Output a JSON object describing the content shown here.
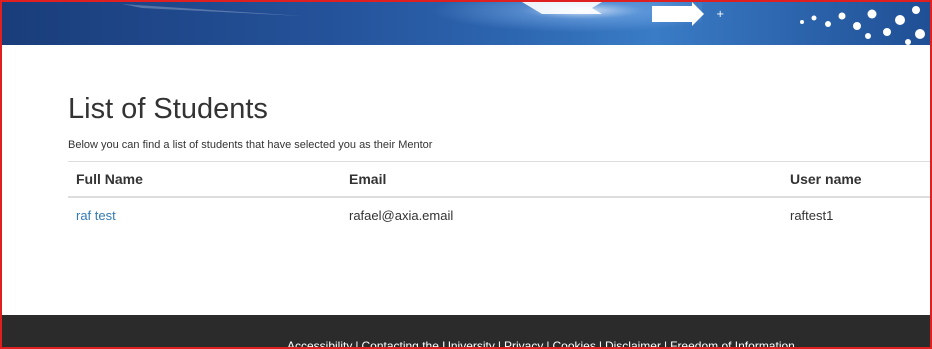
{
  "banner": {
    "icon": "university-banner-graphic"
  },
  "main": {
    "title": "List of Students",
    "intro": "Below you can find a list of students that have selected you as their Mentor",
    "table": {
      "headers": [
        "Full Name",
        "Email",
        "User name"
      ],
      "rows": [
        {
          "full_name": "raf test",
          "email": "rafael@axia.email",
          "user_name": "raftest1"
        }
      ]
    }
  },
  "footer": {
    "links": [
      "Accessibility",
      "Contacting the University",
      "Privacy",
      "Cookies",
      "Disclaimer",
      "Freedom of Information"
    ],
    "separator": "|"
  },
  "colors": {
    "frame_border": "#e02020",
    "banner_blue": "#24529a",
    "link": "#337ab7",
    "footer_bg": "#2b2b2b"
  }
}
